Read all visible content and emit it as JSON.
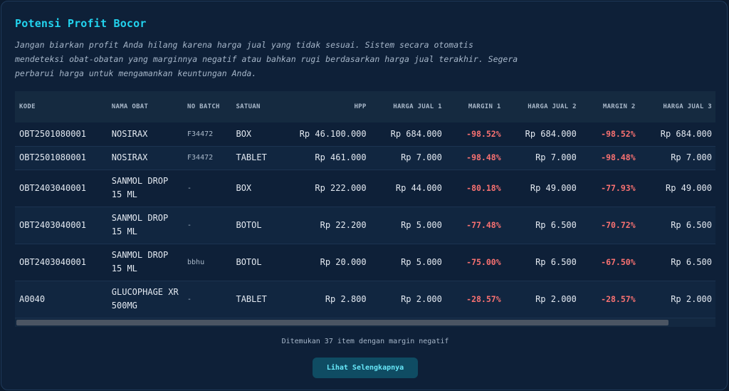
{
  "panel": {
    "title": "Potensi Profit Bocor",
    "description": "Jangan biarkan profit Anda hilang karena harga jual yang tidak sesuai. Sistem secara otomatis mendeteksi obat-obatan yang marginnya negatif atau bahkan rugi berdasarkan harga jual terakhir. Segera perbarui harga untuk mengamankan keuntungan Anda."
  },
  "table": {
    "headers": {
      "kode": "KODE",
      "nama": "NAMA OBAT",
      "batch": "NO BATCH",
      "satuan": "SATUAN",
      "hpp": "HPP",
      "harga1": "HARGA JUAL 1",
      "margin1": "MARGIN 1",
      "harga2": "HARGA JUAL 2",
      "margin2": "MARGIN 2",
      "harga3": "HARGA JUAL 3"
    },
    "rows": [
      {
        "kode": "OBT2501080001",
        "nama": "NOSIRAX",
        "batch": "F34472",
        "satuan": "BOX",
        "hpp": "Rp 46.100.000",
        "harga1": "Rp 684.000",
        "margin1": "-98.52%",
        "harga2": "Rp 684.000",
        "margin2": "-98.52%",
        "harga3": "Rp 684.000"
      },
      {
        "kode": "OBT2501080001",
        "nama": "NOSIRAX",
        "batch": "F34472",
        "satuan": "TABLET",
        "hpp": "Rp 461.000",
        "harga1": "Rp 7.000",
        "margin1": "-98.48%",
        "harga2": "Rp 7.000",
        "margin2": "-98.48%",
        "harga3": "Rp 7.000"
      },
      {
        "kode": "OBT2403040001",
        "nama": "SANMOL DROP 15 ML",
        "batch": "-",
        "satuan": "BOX",
        "hpp": "Rp 222.000",
        "harga1": "Rp 44.000",
        "margin1": "-80.18%",
        "harga2": "Rp 49.000",
        "margin2": "-77.93%",
        "harga3": "Rp 49.000"
      },
      {
        "kode": "OBT2403040001",
        "nama": "SANMOL DROP 15 ML",
        "batch": "-",
        "satuan": "BOTOL",
        "hpp": "Rp 22.200",
        "harga1": "Rp 5.000",
        "margin1": "-77.48%",
        "harga2": "Rp 6.500",
        "margin2": "-70.72%",
        "harga3": "Rp 6.500"
      },
      {
        "kode": "OBT2403040001",
        "nama": "SANMOL DROP 15 ML",
        "batch": "bbhu",
        "satuan": "BOTOL",
        "hpp": "Rp 20.000",
        "harga1": "Rp 5.000",
        "margin1": "-75.00%",
        "harga2": "Rp 6.500",
        "margin2": "-67.50%",
        "harga3": "Rp 6.500"
      },
      {
        "kode": "A0040",
        "nama": "GLUCOPHAGE XR 500MG",
        "batch": "-",
        "satuan": "TABLET",
        "hpp": "Rp 2.800",
        "harga1": "Rp 2.000",
        "margin1": "-28.57%",
        "harga2": "Rp 2.000",
        "margin2": "-28.57%",
        "harga3": "Rp 2.000"
      }
    ]
  },
  "footer": {
    "found_text": "Ditemukan 37 item dengan margin negatif",
    "button_label": "Lihat Selengkapnya"
  },
  "colors": {
    "accent": "#22d3ee",
    "negative": "#f87171",
    "background": "#0e2038"
  }
}
